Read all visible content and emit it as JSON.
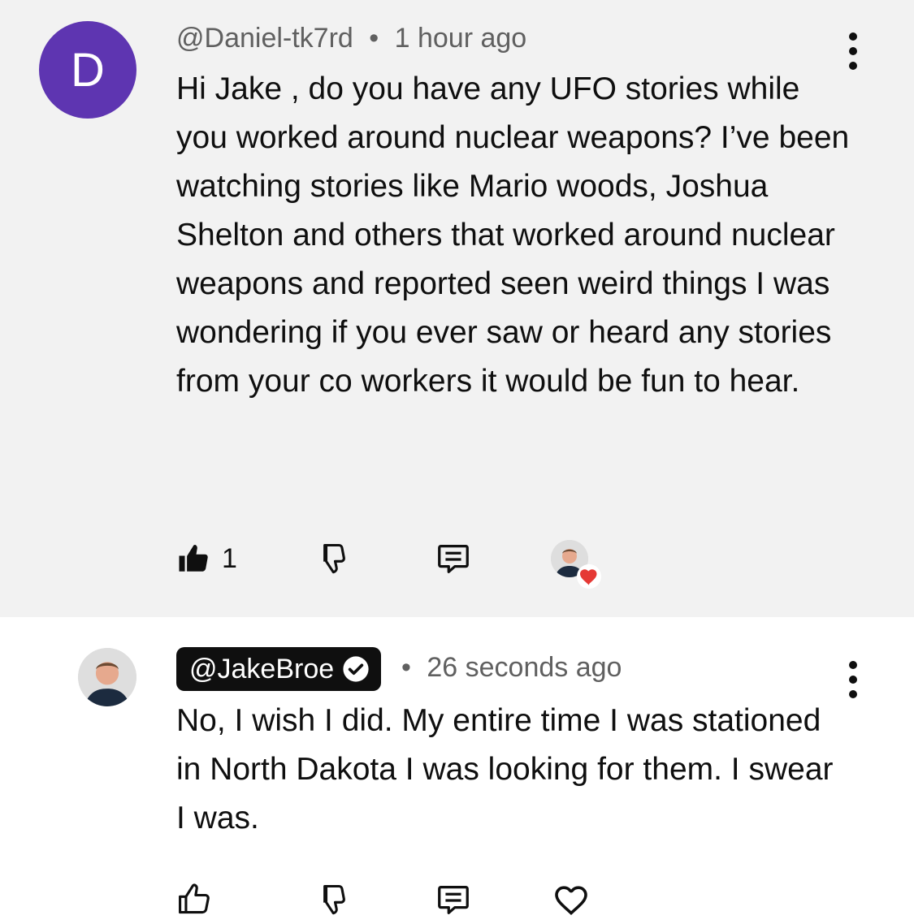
{
  "comment": {
    "avatar_letter": "D",
    "author": "@Daniel-tk7rd",
    "separator": "•",
    "time": "1 hour ago",
    "text": "Hi Jake , do you have any UFO stories while you worked around nuclear weapons? I’ve been watching stories like Mario woods, Joshua Shelton and others that worked around nuclear weapons and reported seen weird things I was wondering if you ever saw or heard any stories from your co workers it would be fun to hear.",
    "like_count": "1",
    "liked": true,
    "hearted_by_creator": true
  },
  "reply": {
    "author": "@JakeBroe",
    "verified": true,
    "separator": "•",
    "time": "26 seconds ago",
    "text": "No, I wish I did.  My entire time I was stationed in North Dakota I was looking for them.  I swear I was."
  },
  "icons": {
    "like": "thumbs-up-icon",
    "dislike": "thumbs-down-icon",
    "reply": "comment-icon",
    "heart": "heart-icon",
    "more": "more-vert-icon",
    "verified": "check-circle-icon"
  },
  "colors": {
    "avatar_purple": "#5e35b1",
    "heart_red": "#e53935",
    "top_background": "#f2f2f2",
    "text": "#0f0f0f",
    "meta_text": "#606060"
  }
}
